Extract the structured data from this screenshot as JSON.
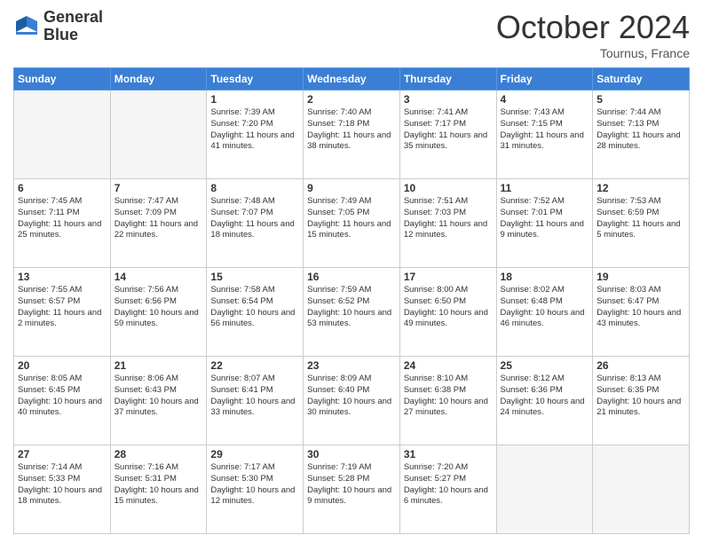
{
  "header": {
    "logo_line1": "General",
    "logo_line2": "Blue",
    "month": "October 2024",
    "location": "Tournus, France"
  },
  "days_of_week": [
    "Sunday",
    "Monday",
    "Tuesday",
    "Wednesday",
    "Thursday",
    "Friday",
    "Saturday"
  ],
  "weeks": [
    [
      {
        "day": "",
        "info": ""
      },
      {
        "day": "",
        "info": ""
      },
      {
        "day": "1",
        "info": "Sunrise: 7:39 AM\nSunset: 7:20 PM\nDaylight: 11 hours and 41 minutes."
      },
      {
        "day": "2",
        "info": "Sunrise: 7:40 AM\nSunset: 7:18 PM\nDaylight: 11 hours and 38 minutes."
      },
      {
        "day": "3",
        "info": "Sunrise: 7:41 AM\nSunset: 7:17 PM\nDaylight: 11 hours and 35 minutes."
      },
      {
        "day": "4",
        "info": "Sunrise: 7:43 AM\nSunset: 7:15 PM\nDaylight: 11 hours and 31 minutes."
      },
      {
        "day": "5",
        "info": "Sunrise: 7:44 AM\nSunset: 7:13 PM\nDaylight: 11 hours and 28 minutes."
      }
    ],
    [
      {
        "day": "6",
        "info": "Sunrise: 7:45 AM\nSunset: 7:11 PM\nDaylight: 11 hours and 25 minutes."
      },
      {
        "day": "7",
        "info": "Sunrise: 7:47 AM\nSunset: 7:09 PM\nDaylight: 11 hours and 22 minutes."
      },
      {
        "day": "8",
        "info": "Sunrise: 7:48 AM\nSunset: 7:07 PM\nDaylight: 11 hours and 18 minutes."
      },
      {
        "day": "9",
        "info": "Sunrise: 7:49 AM\nSunset: 7:05 PM\nDaylight: 11 hours and 15 minutes."
      },
      {
        "day": "10",
        "info": "Sunrise: 7:51 AM\nSunset: 7:03 PM\nDaylight: 11 hours and 12 minutes."
      },
      {
        "day": "11",
        "info": "Sunrise: 7:52 AM\nSunset: 7:01 PM\nDaylight: 11 hours and 9 minutes."
      },
      {
        "day": "12",
        "info": "Sunrise: 7:53 AM\nSunset: 6:59 PM\nDaylight: 11 hours and 5 minutes."
      }
    ],
    [
      {
        "day": "13",
        "info": "Sunrise: 7:55 AM\nSunset: 6:57 PM\nDaylight: 11 hours and 2 minutes."
      },
      {
        "day": "14",
        "info": "Sunrise: 7:56 AM\nSunset: 6:56 PM\nDaylight: 10 hours and 59 minutes."
      },
      {
        "day": "15",
        "info": "Sunrise: 7:58 AM\nSunset: 6:54 PM\nDaylight: 10 hours and 56 minutes."
      },
      {
        "day": "16",
        "info": "Sunrise: 7:59 AM\nSunset: 6:52 PM\nDaylight: 10 hours and 53 minutes."
      },
      {
        "day": "17",
        "info": "Sunrise: 8:00 AM\nSunset: 6:50 PM\nDaylight: 10 hours and 49 minutes."
      },
      {
        "day": "18",
        "info": "Sunrise: 8:02 AM\nSunset: 6:48 PM\nDaylight: 10 hours and 46 minutes."
      },
      {
        "day": "19",
        "info": "Sunrise: 8:03 AM\nSunset: 6:47 PM\nDaylight: 10 hours and 43 minutes."
      }
    ],
    [
      {
        "day": "20",
        "info": "Sunrise: 8:05 AM\nSunset: 6:45 PM\nDaylight: 10 hours and 40 minutes."
      },
      {
        "day": "21",
        "info": "Sunrise: 8:06 AM\nSunset: 6:43 PM\nDaylight: 10 hours and 37 minutes."
      },
      {
        "day": "22",
        "info": "Sunrise: 8:07 AM\nSunset: 6:41 PM\nDaylight: 10 hours and 33 minutes."
      },
      {
        "day": "23",
        "info": "Sunrise: 8:09 AM\nSunset: 6:40 PM\nDaylight: 10 hours and 30 minutes."
      },
      {
        "day": "24",
        "info": "Sunrise: 8:10 AM\nSunset: 6:38 PM\nDaylight: 10 hours and 27 minutes."
      },
      {
        "day": "25",
        "info": "Sunrise: 8:12 AM\nSunset: 6:36 PM\nDaylight: 10 hours and 24 minutes."
      },
      {
        "day": "26",
        "info": "Sunrise: 8:13 AM\nSunset: 6:35 PM\nDaylight: 10 hours and 21 minutes."
      }
    ],
    [
      {
        "day": "27",
        "info": "Sunrise: 7:14 AM\nSunset: 5:33 PM\nDaylight: 10 hours and 18 minutes."
      },
      {
        "day": "28",
        "info": "Sunrise: 7:16 AM\nSunset: 5:31 PM\nDaylight: 10 hours and 15 minutes."
      },
      {
        "day": "29",
        "info": "Sunrise: 7:17 AM\nSunset: 5:30 PM\nDaylight: 10 hours and 12 minutes."
      },
      {
        "day": "30",
        "info": "Sunrise: 7:19 AM\nSunset: 5:28 PM\nDaylight: 10 hours and 9 minutes."
      },
      {
        "day": "31",
        "info": "Sunrise: 7:20 AM\nSunset: 5:27 PM\nDaylight: 10 hours and 6 minutes."
      },
      {
        "day": "",
        "info": ""
      },
      {
        "day": "",
        "info": ""
      }
    ]
  ]
}
